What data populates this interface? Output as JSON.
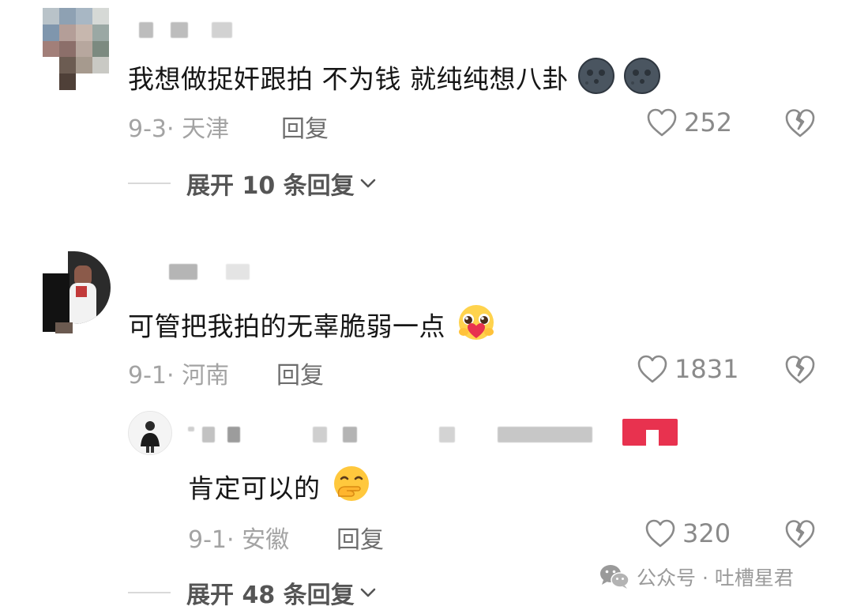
{
  "comments": [
    {
      "text": "我想做捉奸跟拍 不为钱 就纯纯想八卦",
      "emoji": "new-moon-face-emoji",
      "date": "9-3",
      "separator": "·",
      "location": "天津",
      "reply_label": "回复",
      "likes": "252",
      "expand_label": "展开 10 条回复"
    },
    {
      "text": "可管把我拍的无辜脆弱一点",
      "emoji": "pleading-face-holding-heart-emoji",
      "date": "9-1",
      "separator": "·",
      "location": "河南",
      "reply_label": "回复",
      "likes": "1831"
    }
  ],
  "reply": {
    "text": "肯定可以的",
    "emoji": "hand-over-mouth-emoji",
    "date": "9-1",
    "separator": "·",
    "location": "安徽",
    "reply_label": "回复",
    "likes": "320",
    "expand_label": "展开 48 条回复"
  },
  "watermark": {
    "text": "公众号 · 吐槽星君",
    "icon": "wechat-icon"
  },
  "colors": {
    "text": "#161616",
    "meta": "#a3a3a3",
    "icon": "#8a8a8a",
    "badge": "#e8324f"
  }
}
